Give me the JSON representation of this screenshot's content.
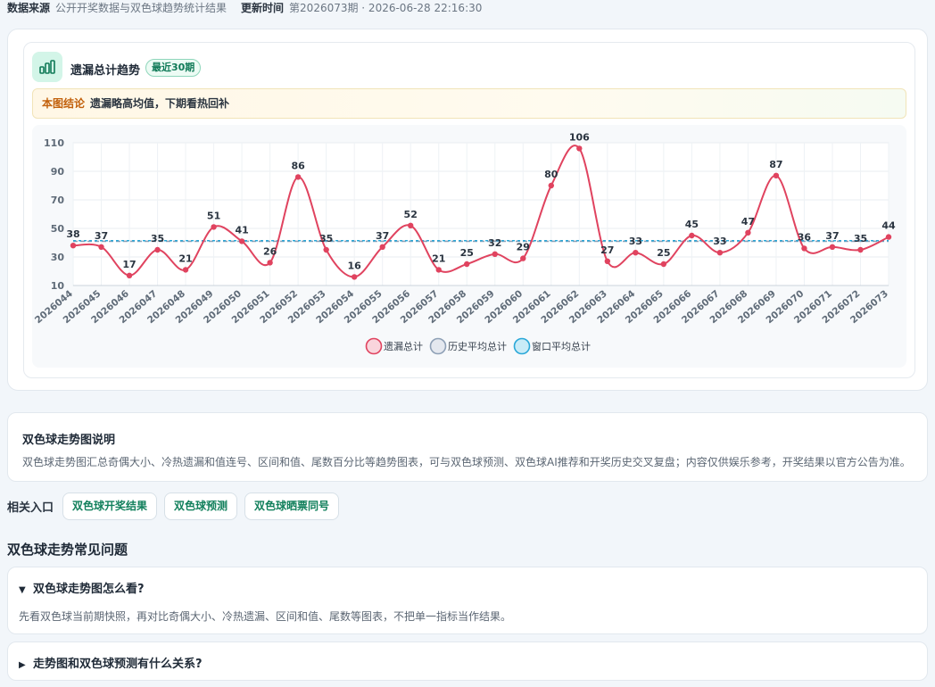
{
  "meta": {
    "source_label": "数据来源",
    "source_value": "公开开奖数据与双色球趋势统计结果",
    "update_label": "更新时间",
    "update_value": "第2026073期 · 2026-06-28 22:16:30"
  },
  "chart_card": {
    "title": "遗漏总计趋势",
    "badge": "最近30期",
    "conclusion_label": "本图结论",
    "conclusion_text": "遗漏略高均值，下期看热回补"
  },
  "colors": {
    "series": "#e0435f",
    "hist_avg": "#8ea0b6",
    "window_avg": "#2aa8d8",
    "accent": "#0f7a57"
  },
  "chart_data": {
    "type": "line",
    "x": [
      "2026044",
      "2026045",
      "2026046",
      "2026047",
      "2026048",
      "2026049",
      "2026050",
      "2026051",
      "2026052",
      "2026053",
      "2026054",
      "2026055",
      "2026056",
      "2026057",
      "2026058",
      "2026059",
      "2026060",
      "2026061",
      "2026062",
      "2026063",
      "2026064",
      "2026065",
      "2026066",
      "2026067",
      "2026068",
      "2026069",
      "2026070",
      "2026071",
      "2026072",
      "2026073"
    ],
    "series": [
      {
        "name": "遗漏总计",
        "values": [
          38,
          37,
          17,
          35,
          21,
          51,
          41,
          26,
          86,
          35,
          16,
          37,
          52,
          21,
          25,
          32,
          29,
          80,
          106,
          27,
          33,
          25,
          45,
          33,
          47,
          87,
          36,
          37,
          35,
          44
        ]
      },
      {
        "name": "历史平均总计",
        "value": 41
      },
      {
        "name": "窗口平均总计",
        "value": 41.4
      }
    ],
    "y_ticks": [
      "10",
      "30",
      "50",
      "70",
      "90",
      "110"
    ],
    "ylim": [
      10,
      110
    ],
    "grid": true,
    "legend": "bottom-center"
  },
  "description": {
    "title": "双色球走势图说明",
    "text": "双色球走势图汇总奇偶大小、冷热遗漏和值连号、区间和值、尾数百分比等趋势图表，可与双色球预测、双色球AI推荐和开奖历史交叉复盘；内容仅供娱乐参考，开奖结果以官方公告为准。"
  },
  "related": {
    "label": "相关入口",
    "links": [
      "双色球开奖结果",
      "双色球预测",
      "双色球晒票同号"
    ]
  },
  "faq": {
    "title": "双色球走势常见问题",
    "items": [
      {
        "arrow": "▼",
        "question": "双色球走势图怎么看?",
        "answer": "先看双色球当前期快照，再对比奇偶大小、冷热遗漏、区间和值、尾数等图表，不把单一指标当作结果。"
      },
      {
        "arrow": "▶",
        "question": "走势图和双色球预测有什么关系?"
      }
    ]
  }
}
